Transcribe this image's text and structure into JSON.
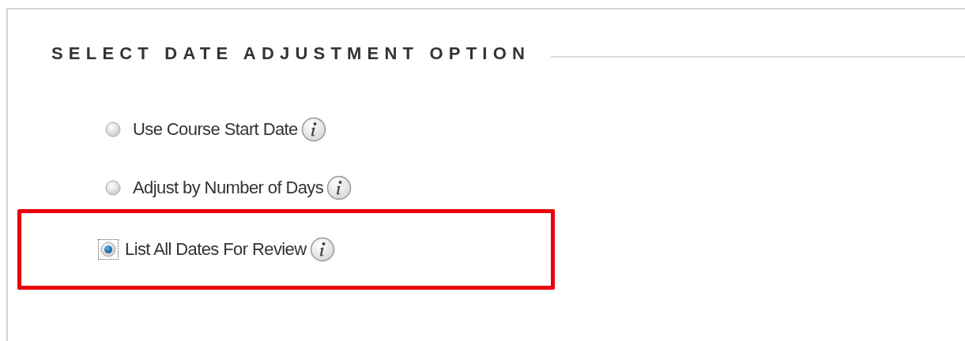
{
  "section": {
    "title": "SELECT DATE ADJUSTMENT OPTION"
  },
  "options": [
    {
      "label": "Use Course Start Date",
      "selected": false,
      "focused": false,
      "highlighted": false
    },
    {
      "label": "Adjust by Number of Days",
      "selected": false,
      "focused": false,
      "highlighted": false
    },
    {
      "label": "List All Dates For Review",
      "selected": true,
      "focused": true,
      "highlighted": true
    }
  ]
}
